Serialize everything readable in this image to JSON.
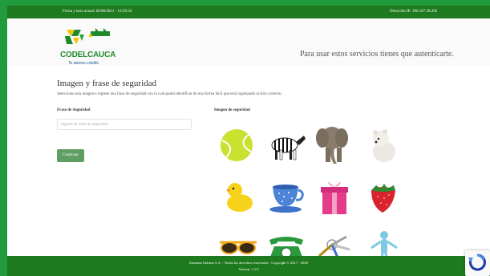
{
  "topbar": {
    "datetime": "Fecha y hora actual: 02/06/2021 - 13:59:34",
    "ip": "Dirección IP: 190.107.28.202"
  },
  "header": {
    "logo_text": "CODELCAUCA",
    "logo_tagline": "Te damos crédito",
    "auth_message": "Para usar estos servicios tienes que autenticarte."
  },
  "form": {
    "title": "Imagen y frase de seguridad",
    "instructions": "Seleccione una imagen e ingrese una frase de seguridad con la cual podrá identificar de una forma fácil que está ingresando al sitio correcto.",
    "phrase_label": "Frase de Seguridad",
    "phrase_placeholder": "Ingrese su frase de seguridad",
    "phrase_value": "",
    "images_label": "Imagen de seguridad",
    "continue_button": "Continuar"
  },
  "images": [
    {
      "name": "tennis-ball"
    },
    {
      "name": "zebra"
    },
    {
      "name": "elephant"
    },
    {
      "name": "polar-bear"
    },
    {
      "name": "rubber-duck"
    },
    {
      "name": "teacup"
    },
    {
      "name": "gift-box"
    },
    {
      "name": "strawberry"
    },
    {
      "name": "sunglasses"
    },
    {
      "name": "telephone"
    },
    {
      "name": "keys"
    },
    {
      "name": "human-figure"
    }
  ],
  "footer": {
    "copyright": "Sistemas Enlinea S.A. - Todos los derechos reservados - Copyright © 2017 - 2020",
    "version": "Version: 1.1.0"
  },
  "colors": {
    "outer_border": "#1f9a3c",
    "topbar": "#1e7a1e",
    "button": "#5e9e62",
    "logo_green": "#1e8a2a",
    "logo_yellow": "#f2c500"
  }
}
